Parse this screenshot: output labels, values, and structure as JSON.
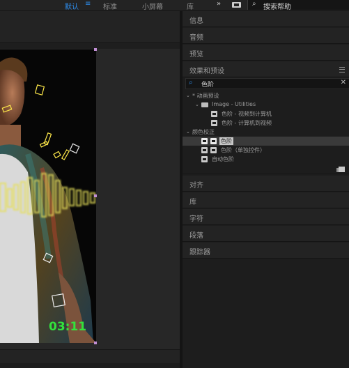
{
  "topbar": {
    "workspaces": [
      "默认",
      "标准",
      "小屏幕",
      "库"
    ],
    "active_workspace": "默认",
    "overflow_label": "»",
    "search_icon": "⌕",
    "search_placeholder": "搜索帮助"
  },
  "composition": {
    "timecode": "03:11"
  },
  "panels": {
    "info": "信息",
    "audio": "音频",
    "preview": "预览",
    "effects_presets": "效果和预设",
    "align": "对齐",
    "library": "库",
    "character": "字符",
    "paragraph": "段落",
    "tracker": "跟踪器"
  },
  "effects": {
    "search_icon": "⌕",
    "search_value": "色阶",
    "clear_icon": "✕",
    "tree": [
      {
        "label": "* 动画预设",
        "level": 0,
        "type": "group"
      },
      {
        "label": "Image - Utilities",
        "level": 1,
        "type": "folder"
      },
      {
        "label": "色阶 - 视频到计算机",
        "level": 2,
        "type": "preset"
      },
      {
        "label": "色阶 - 计算机到视频",
        "level": 2,
        "type": "preset"
      },
      {
        "label": "颜色校正",
        "level": 0,
        "type": "group"
      },
      {
        "label": "色阶",
        "level": 1,
        "type": "effect",
        "selected": true
      },
      {
        "label": "色阶（单独控件）",
        "level": 1,
        "type": "effect"
      },
      {
        "label": "自动色阶",
        "level": 1,
        "type": "effect"
      }
    ]
  },
  "colors": {
    "accent": "#2d8ceb",
    "timecode": "#33e23c",
    "handle": "#c28fd6",
    "glow": "#e6e05a"
  }
}
